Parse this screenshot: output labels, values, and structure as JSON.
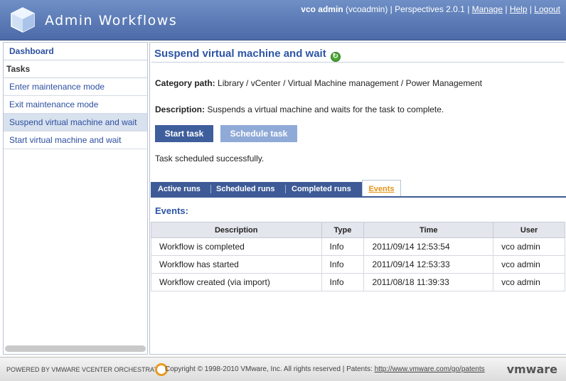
{
  "header": {
    "app_title": "Admin Workflows",
    "user_name": "vco admin",
    "user_login": "(vcoadmin)",
    "perspectives": "Perspectives 2.0.1",
    "links": [
      "Manage",
      "Help",
      "Logout"
    ]
  },
  "sidebar": {
    "dashboard": "Dashboard",
    "tasks_heading": "Tasks",
    "items": [
      {
        "label": "Enter maintenance mode"
      },
      {
        "label": "Exit maintenance mode"
      },
      {
        "label": "Suspend virtual machine and wait",
        "active": true
      },
      {
        "label": "Start virtual machine and wait"
      }
    ]
  },
  "main": {
    "title": "Suspend virtual machine and wait",
    "category_label": "Category path:",
    "category_value": "Library / vCenter / Virtual Machine management / Power Management",
    "description_label": "Description:",
    "description_value": "Suspends a virtual machine and waits for the task to complete.",
    "start_button": "Start task",
    "schedule_button": "Schedule task",
    "status": "Task scheduled successfully.",
    "tabs": [
      "Active runs",
      "Scheduled runs",
      "Completed runs",
      "Events"
    ],
    "events_title": "Events:",
    "table": {
      "columns": [
        "Description",
        "Type",
        "Time",
        "User"
      ],
      "rows": [
        [
          "Workflow is completed",
          "Info",
          "2011/09/14 12:53:54",
          "vco admin"
        ],
        [
          "Workflow has started",
          "Info",
          "2011/09/14 12:53:33",
          "vco admin"
        ],
        [
          "Workflow created (via import)",
          "Info",
          "2011/08/18 11:39:33",
          "vco admin"
        ]
      ]
    }
  },
  "footer": {
    "powered_by": "POWERED BY VMWARE VCENTER ORCHESTRATOR",
    "copyright": "Copyright © 1998-2010 VMware, Inc. All rights reserved | Patents:",
    "patents_link": "http://www.vmware.com/go/patents",
    "brand": "vmware"
  },
  "colors": {
    "header": "#4c6aa8",
    "link": "#2c4fa0",
    "active_tab": "#e59416",
    "primary_button": "#3f5e9c",
    "secondary_button": "#90aad7"
  }
}
